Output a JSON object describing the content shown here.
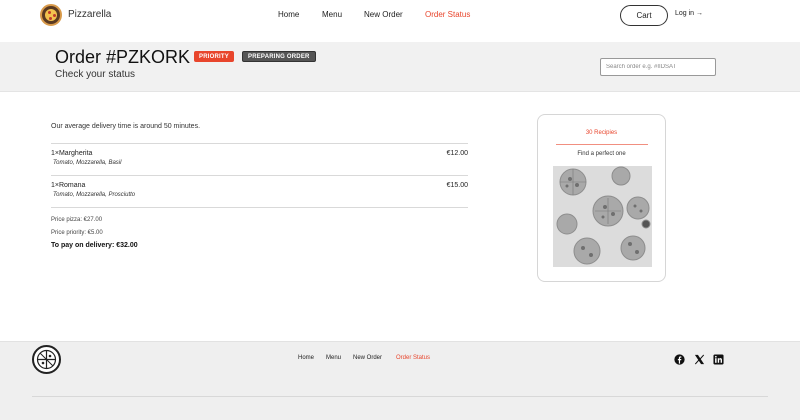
{
  "header": {
    "brand": "Pizzarella",
    "nav": [
      {
        "label": "Home",
        "active": false
      },
      {
        "label": "Menu",
        "active": false
      },
      {
        "label": "New Order",
        "active": false
      },
      {
        "label": "Order Status",
        "active": true
      }
    ],
    "cart_label": "Cart",
    "login_label": "Log in →"
  },
  "title_band": {
    "order_title": "Order #PZKORK",
    "badges": [
      "PRIORITY",
      "PREPARING ORDER"
    ],
    "subtitle": "Check your status",
    "search_placeholder": "Search order e.g. #IIDSAT"
  },
  "order": {
    "eta_text": "Our average delivery time is around 50 minutes.",
    "items": [
      {
        "quantity_name": "1×Margherita",
        "ingredients": "Tomato, Mozzarella, Basil",
        "price": "€12.00"
      },
      {
        "quantity_name": "1×Romana",
        "ingredients": "Tomato, Mozzarella, Prosciutto",
        "price": "€15.00"
      }
    ],
    "price_pizza": "Price pizza: €27.00",
    "price_priority": "Price priority: €5.00",
    "total": "To pay on delivery: €32.00"
  },
  "recipes_card": {
    "title": "30 Recipies",
    "subtitle": "Find a perfect one"
  },
  "footer": {
    "nav": [
      {
        "label": "Home",
        "active": false
      },
      {
        "label": "Menu",
        "active": false
      },
      {
        "label": "New Order",
        "active": false
      },
      {
        "label": "Order Status",
        "active": true
      }
    ],
    "social_icons": [
      "facebook-icon",
      "x-twitter-icon",
      "linkedin-icon"
    ]
  },
  "colors": {
    "accent": "#e8452c",
    "status_badge": "#555555",
    "band_bg": "#f1f1f1",
    "footer_bg": "#efefef"
  }
}
